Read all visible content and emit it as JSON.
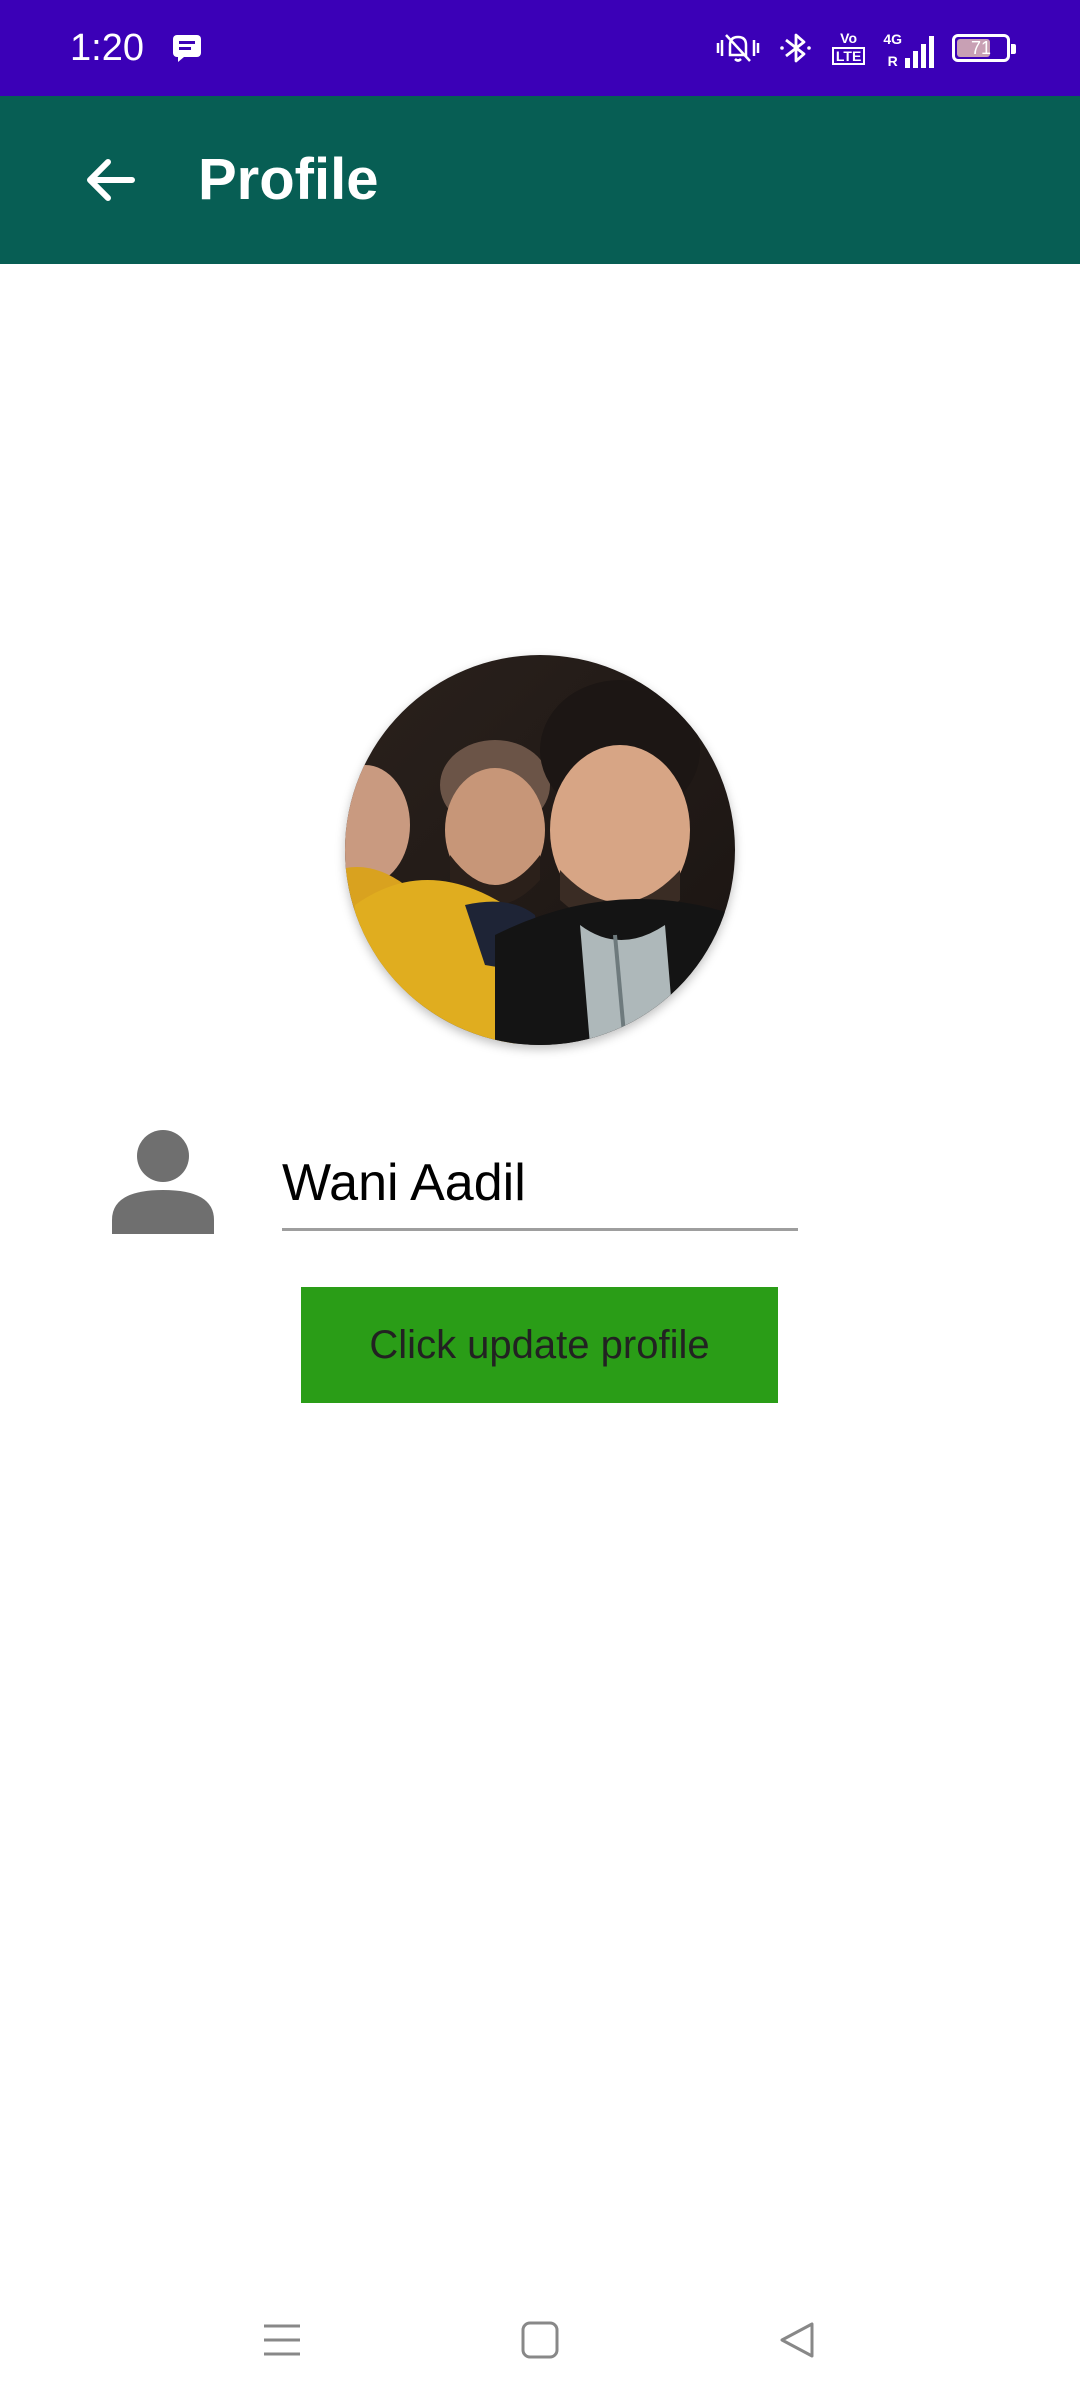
{
  "status_bar": {
    "time": "1:20",
    "network_top": "Vo",
    "network_bottom": "LTE",
    "network_4g": "4G",
    "network_r": "R",
    "battery": "71",
    "battery_level": 0.71,
    "icons": [
      "message-icon",
      "vibrate-icon",
      "bluetooth-icon",
      "volte-icon",
      "signal-icon",
      "battery-icon"
    ]
  },
  "app_bar": {
    "title": "Profile",
    "back_icon": "arrow-back-icon"
  },
  "profile": {
    "photo_icon": "profile-photo",
    "name": "Wani Aadil",
    "update_button": "Click update profile"
  },
  "colors": {
    "status_bar": "#3B00B7",
    "app_bar": "#075E54",
    "button": "#2A9D17"
  },
  "nav_bar": {
    "icons": [
      "menu-icon",
      "home-icon",
      "back-icon"
    ]
  }
}
